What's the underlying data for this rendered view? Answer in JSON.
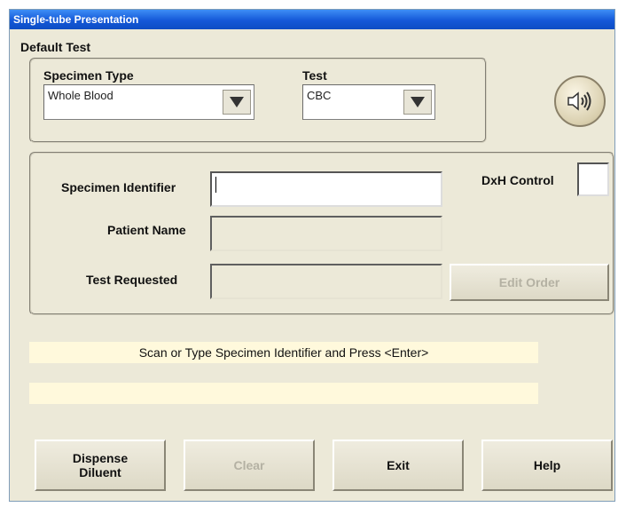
{
  "window": {
    "title": "Single-tube Presentation"
  },
  "default_test": {
    "label": "Default Test",
    "specimen_type": {
      "label": "Specimen Type",
      "value": "Whole Blood"
    },
    "test": {
      "label": "Test",
      "value": "CBC"
    }
  },
  "speaker": {
    "icon": "speaker-icon"
  },
  "form": {
    "specimen_identifier": {
      "label": "Specimen Identifier",
      "value": ""
    },
    "patient_name": {
      "label": "Patient Name",
      "value": ""
    },
    "test_requested": {
      "label": "Test Requested",
      "value": ""
    },
    "dxh_control": {
      "label": "DxH Control",
      "value": ""
    },
    "edit_order_label": "Edit Order"
  },
  "status": {
    "message": "Scan or Type Specimen Identifier and Press <Enter>",
    "secondary": ""
  },
  "buttons": {
    "dispense_line1": "Dispense",
    "dispense_line2": "Diluent",
    "clear": "Clear",
    "exit": "Exit",
    "help": "Help"
  }
}
